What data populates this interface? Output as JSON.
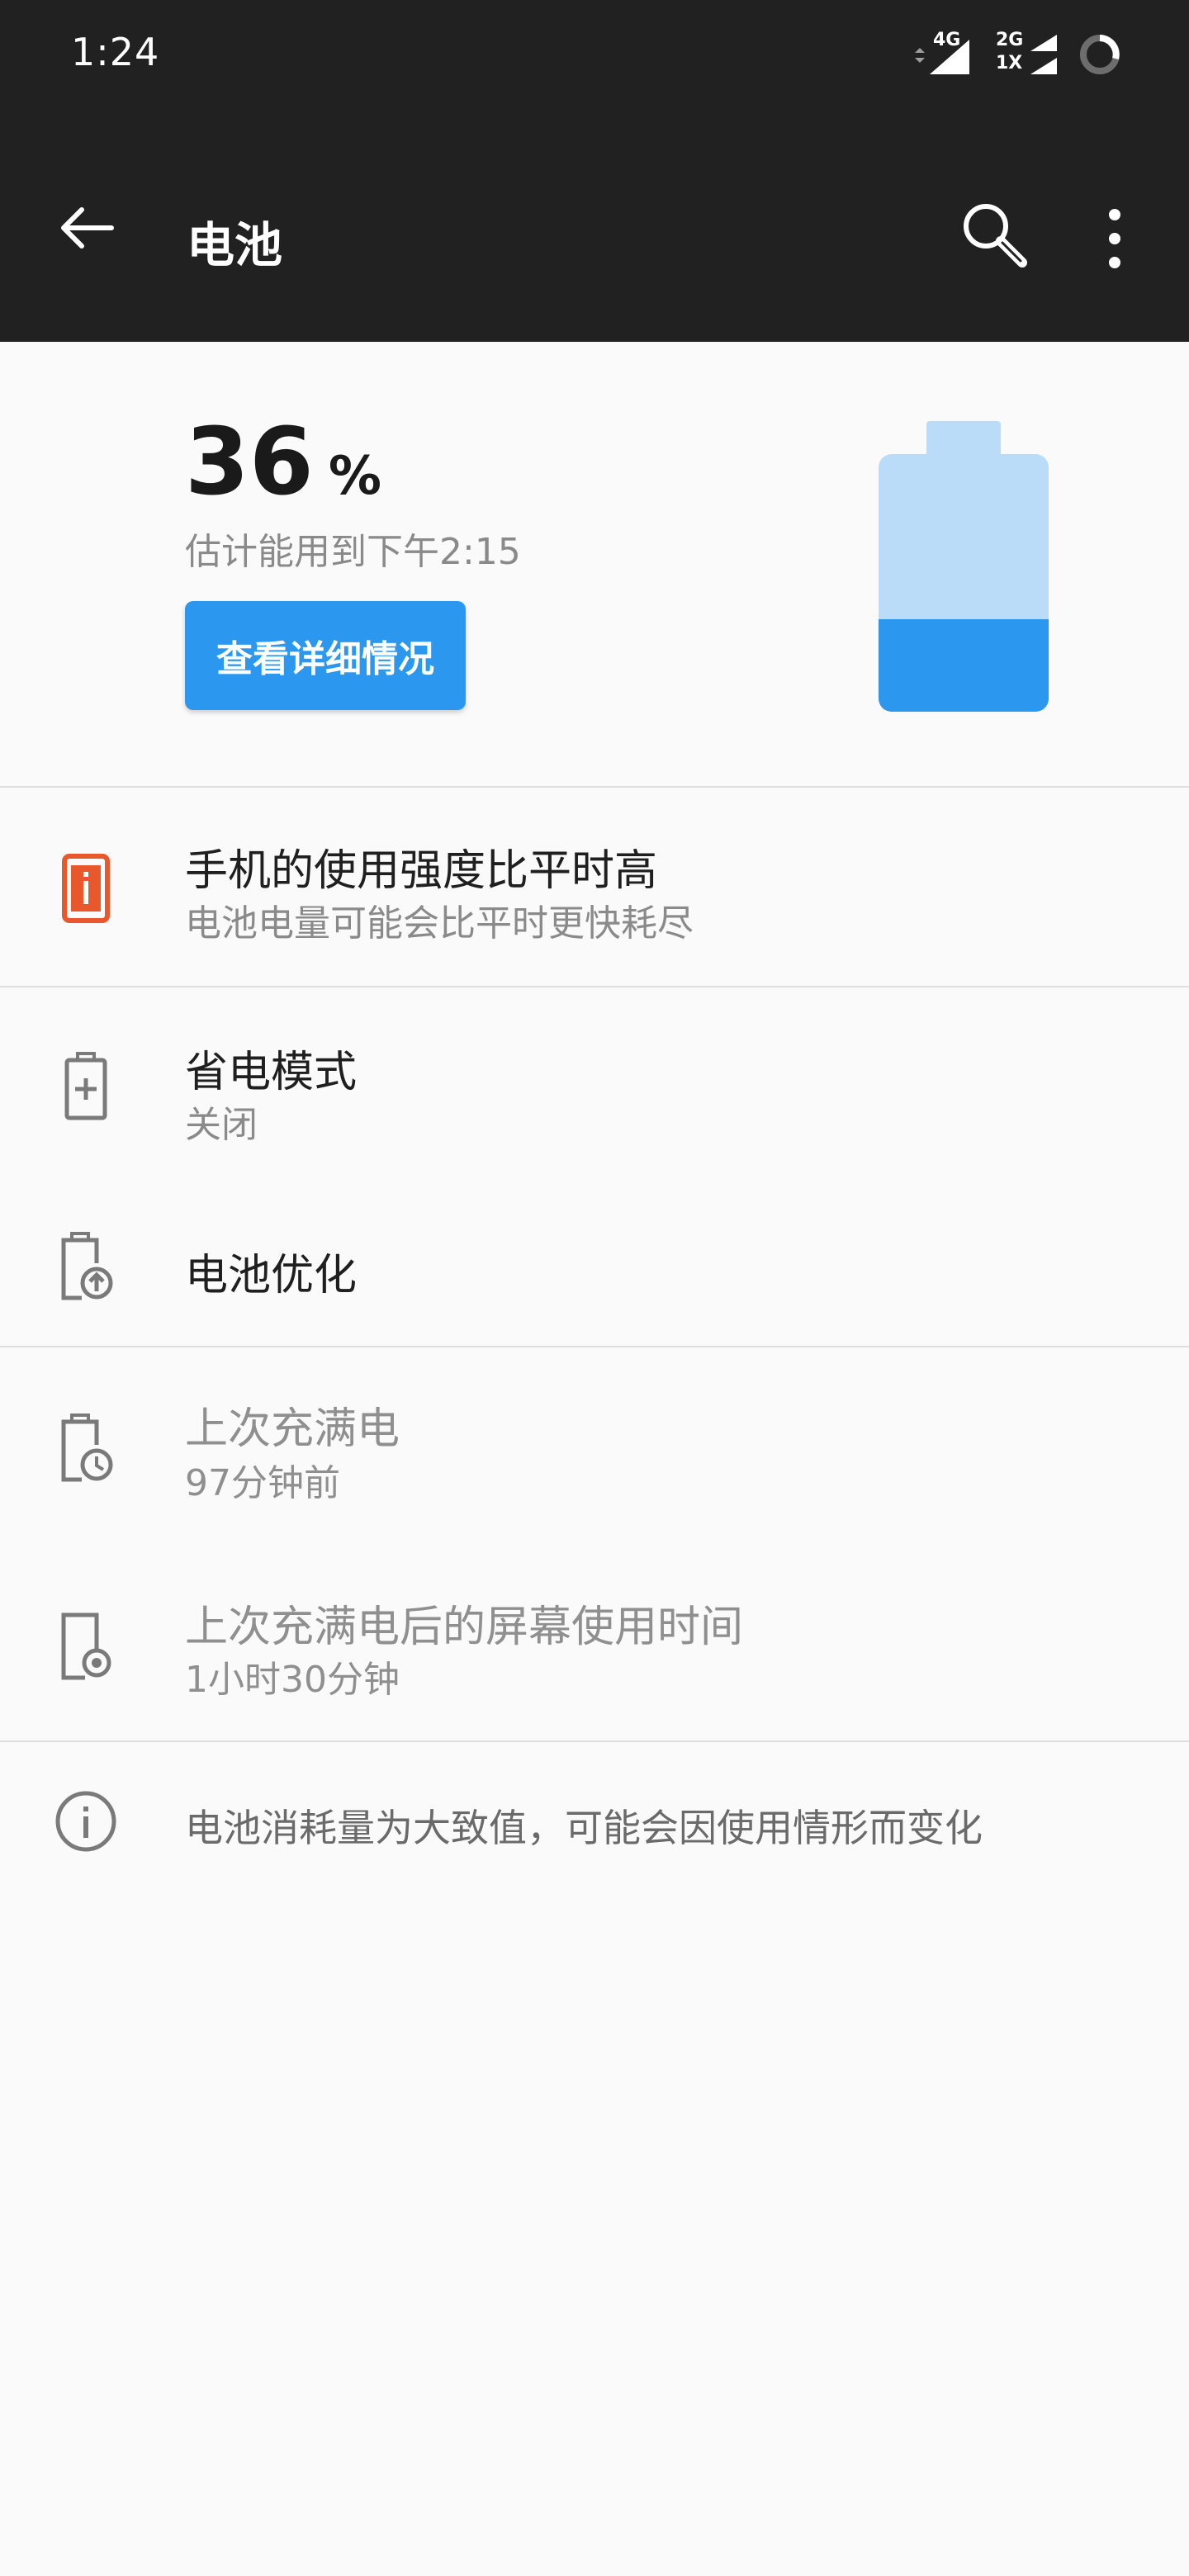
{
  "status_bar": {
    "time": "1:24",
    "network_1": "4G",
    "network_2_top": "2G",
    "network_2_bottom": "1X"
  },
  "app_bar": {
    "title": "电池",
    "icons": [
      "back-arrow-icon",
      "search-icon",
      "more-vert-icon"
    ]
  },
  "battery": {
    "percent_value": "36",
    "percent_sign": "%",
    "estimate": "估计能用到下午2:15",
    "detail_button": "查看详细情况",
    "level_fraction": 0.36,
    "colors": {
      "accent": "#2b97ee",
      "light": "#bbdcf8",
      "warning": "#e8582c"
    }
  },
  "alert": {
    "title": "手机的使用强度比平时高",
    "subtitle": "电池电量可能会比平时更快耗尽",
    "icon": "phone-alert-icon"
  },
  "settings": {
    "power_saving": {
      "title": "省电模式",
      "subtitle": "关闭",
      "icon": "battery-plus-icon"
    },
    "optimization": {
      "title": "电池优化",
      "icon": "battery-optimize-icon"
    }
  },
  "stats": {
    "last_full_charge": {
      "title": "上次充满电",
      "subtitle": "97分钟前",
      "icon": "battery-clock-icon"
    },
    "screen_usage": {
      "title": "上次充满电后的屏幕使用时间",
      "subtitle": "1小时30分钟",
      "icon": "phone-screen-time-icon"
    }
  },
  "footer_note": {
    "text": "电池消耗量为大致值，可能会因使用情形而变化",
    "icon": "info-icon"
  }
}
